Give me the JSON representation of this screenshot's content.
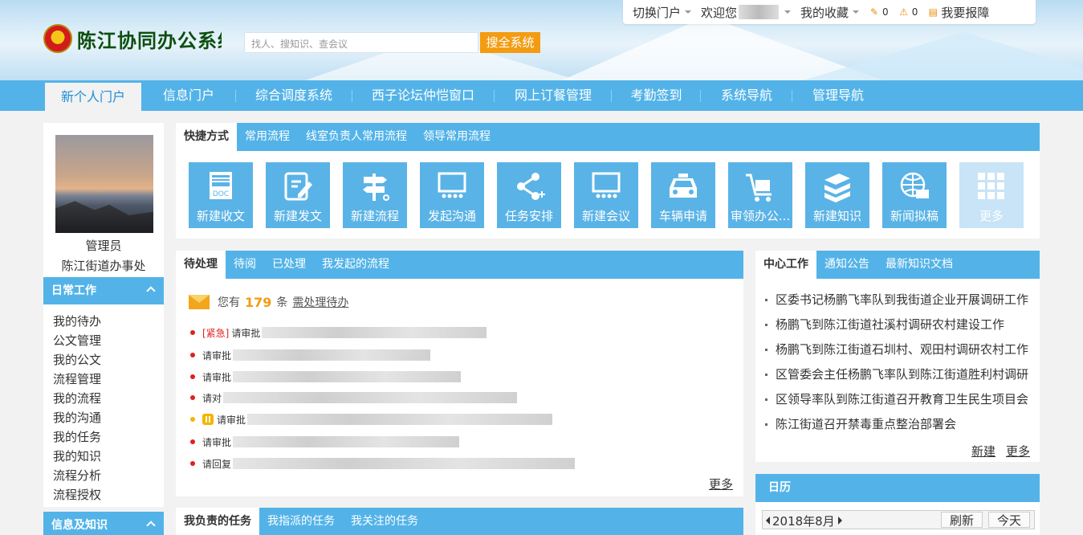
{
  "header": {
    "logo_text": "陈江协同办公系统",
    "search_placeholder": "找人、搜知识、查会议",
    "search_button": "搜全系统",
    "topbar": {
      "switch_portal": "切换门户",
      "welcome": "欢迎您",
      "favorites": "我的收藏",
      "task_count": "0",
      "alert_count": "0",
      "report": "我要报障"
    }
  },
  "nav": {
    "items": [
      "新个人门户",
      "信息门户",
      "综合调度系统",
      "西子论坛仲恺窗口",
      "网上订餐管理",
      "考勤签到",
      "系统导航",
      "管理导航"
    ]
  },
  "profile": {
    "name": "管理员",
    "dept": "陈江街道办事处"
  },
  "sidebar": {
    "daily_title": "日常工作",
    "daily_items": [
      "我的待办",
      "公文管理",
      "我的公文",
      "流程管理",
      "我的流程",
      "我的沟通",
      "我的任务",
      "我的知识",
      "流程分析",
      "流程授权"
    ],
    "info_title": "信息及知识"
  },
  "shortcuts": {
    "tabs": [
      "快捷方式",
      "常用流程",
      "线室负责人常用流程",
      "领导常用流程"
    ],
    "items": [
      "新建收文",
      "新建发文",
      "新建流程",
      "发起沟通",
      "任务安排",
      "新建会议",
      "车辆申请",
      "审领办公...",
      "新建知识",
      "新闻拟稿",
      "更多"
    ],
    "doc_icon_text": "DOC"
  },
  "pending": {
    "tabs": [
      "待处理",
      "待阅",
      "已处理",
      "我发起的流程"
    ],
    "you_have": "您有",
    "count": "179",
    "unit": "条",
    "link": "需处理待办",
    "urgent_tag": "[紧急]",
    "items": [
      "请审批",
      "请审批",
      "请审批",
      "请对",
      "请审批",
      "请审批",
      "请回复"
    ],
    "more": "更多"
  },
  "tasks": {
    "tabs": [
      "我负责的任务",
      "我指派的任务",
      "我关注的任务"
    ]
  },
  "news": {
    "tabs": [
      "中心工作",
      "通知公告",
      "最新知识文档"
    ],
    "items": [
      "区委书记杨鹏飞率队到我街道企业开展调研工作",
      "杨鹏飞到陈江街道社溪村调研农村建设工作",
      "杨鹏飞到陈江街道石圳村、观田村调研农村工作",
      "区管委会主任杨鹏飞率队到陈江街道胜利村调研",
      "区领导率队到陈江街道召开教育卫生民生项目会",
      "陈江街道召开禁毒重点整治部署会"
    ],
    "new_link": "新建",
    "more_link": "更多"
  },
  "calendar": {
    "title": "日历",
    "month": "2018年8月",
    "refresh": "刷新",
    "today": "今天"
  },
  "colors": {
    "primary": "#53b3e8",
    "accent": "#f39c12",
    "urgent": "#e02020"
  }
}
